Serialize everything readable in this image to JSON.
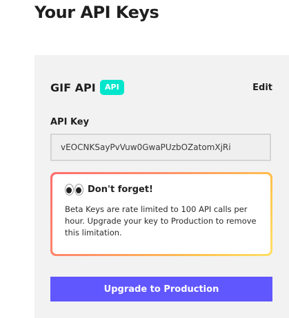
{
  "page": {
    "title": "Your API Keys"
  },
  "app_card": {
    "name": "GIF API",
    "badge": "API",
    "edit_label": "Edit",
    "key_label": "API Key",
    "key_value": "vEOCNKSayPvVuw0GwaPUzbOZatomXjRi",
    "notice": {
      "icon": "eyes-icon",
      "title": "Don't forget!",
      "body": "Beta Keys are rate limited to 100 API calls per hour. Upgrade your key to Production to remove this limitation."
    },
    "upgrade_label": "Upgrade to Production"
  },
  "colors": {
    "badge": "#00e6cc",
    "button": "#6157ff",
    "card_bg": "#f2f2f2",
    "notice_gradient": [
      "#ff6d6d",
      "#ffc24d",
      "#ffe066"
    ]
  }
}
